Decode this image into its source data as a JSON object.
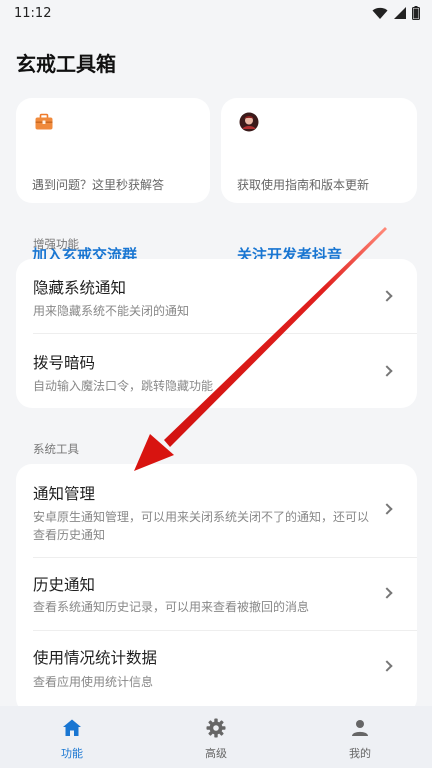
{
  "status_bar": {
    "time": "11:12"
  },
  "app": {
    "title": "玄戒工具箱"
  },
  "quick_cards": [
    {
      "title": "加入玄戒交流群",
      "desc": "遇到问题？这里秒获解答",
      "icon": "briefcase-icon"
    },
    {
      "title": "关注开发者抖音",
      "desc": "获取使用指南和版本更新",
      "icon": "avatar-icon"
    }
  ],
  "sections": {
    "enhance": {
      "label": "增强功能",
      "items": [
        {
          "title": "隐藏系统通知",
          "desc": "用来隐藏系统不能关闭的通知"
        },
        {
          "title": "拨号暗码",
          "desc": "自动输入魔法口令，跳转隐藏功能"
        }
      ]
    },
    "system": {
      "label": "系统工具",
      "items": [
        {
          "title": "通知管理",
          "desc": "安卓原生通知管理，可以用来关闭系统关闭不了的通知，还可以查看历史通知"
        },
        {
          "title": "历史通知",
          "desc": "查看系统通知历史记录，可以用来查看被撤回的消息"
        },
        {
          "title": "使用情况统计数据",
          "desc": "查看应用使用统计信息"
        }
      ]
    }
  },
  "bottom_nav": [
    {
      "label": "功能",
      "icon": "home-icon",
      "active": true
    },
    {
      "label": "高级",
      "icon": "gear-icon",
      "active": false
    },
    {
      "label": "我的",
      "icon": "person-icon",
      "active": false
    }
  ],
  "colors": {
    "accent": "#1976d2",
    "arrow": "#e0201e",
    "card": "#ffffff",
    "background": "#f4f5f7"
  }
}
